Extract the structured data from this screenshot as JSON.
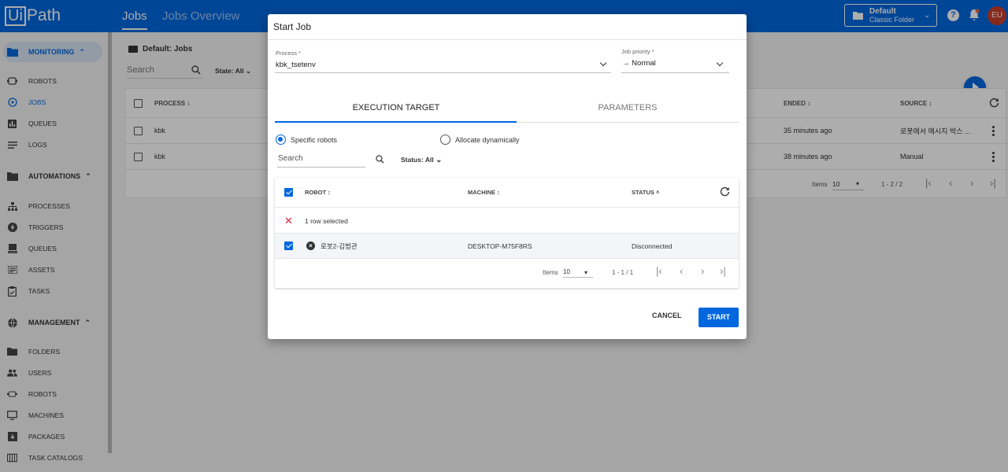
{
  "app": {
    "logo_box": "Ui",
    "logo_rest": "Path",
    "tabs": [
      "Jobs",
      "Jobs Overview"
    ],
    "folder": {
      "name": "Default",
      "type": "Classic Folder"
    },
    "avatar_initials": "EU"
  },
  "sidebar": {
    "sections": [
      {
        "label": "MONITORING",
        "icon": "folder-icon"
      },
      {
        "label": "AUTOMATIONS",
        "icon": "folder-icon"
      },
      {
        "label": "MANAGEMENT",
        "icon": "globe-icon"
      }
    ],
    "monitoring_items": [
      "ROBOTS",
      "JOBS",
      "QUEUES",
      "LOGS"
    ],
    "automation_items": [
      "PROCESSES",
      "TRIGGERS",
      "QUEUES",
      "ASSETS",
      "TASKS"
    ],
    "management_items": [
      "FOLDERS",
      "USERS",
      "ROBOTS",
      "MACHINES",
      "PACKAGES",
      "TASK CATALOGS"
    ]
  },
  "background": {
    "breadcrumb": "Default: Jobs",
    "search_placeholder": "Search",
    "state_filter": "State: All",
    "columns": {
      "process": "PROCESS",
      "ended": "ENDED",
      "source": "SOURCE"
    },
    "rows": [
      {
        "process": "kbk",
        "ended": "35 minutes ago",
        "source": "로봇에서 메시지 박스 ..."
      },
      {
        "process": "kbk",
        "ended": "38 minutes ago",
        "source": "Manual"
      }
    ],
    "pager": {
      "items_label": "Items",
      "items_value": "10",
      "range": "1 - 2 / 2"
    }
  },
  "modal": {
    "title": "Start Job",
    "process_label": "Process *",
    "process_value": "kbk_tsetenv",
    "priority_label": "Job priority *",
    "priority_value": "Normal",
    "tabs": [
      "EXECUTION TARGET",
      "PARAMETERS"
    ],
    "radio_specific": "Specific robots",
    "radio_dynamic": "Allocate dynamically",
    "search_placeholder": "Search",
    "status_filter": "Status: All",
    "columns": {
      "robot": "ROBOT",
      "machine": "MACHINE",
      "status": "STATUS"
    },
    "selection_text": "1 row selected",
    "robot_rows": [
      {
        "robot": "로봇2-김범관",
        "machine": "DESKTOP-M75F8RS",
        "status": "Disconnected"
      }
    ],
    "pager": {
      "items_label": "Items",
      "items_value": "10",
      "range": "1 - 1 / 1"
    },
    "cancel_label": "CANCEL",
    "start_label": "START"
  }
}
